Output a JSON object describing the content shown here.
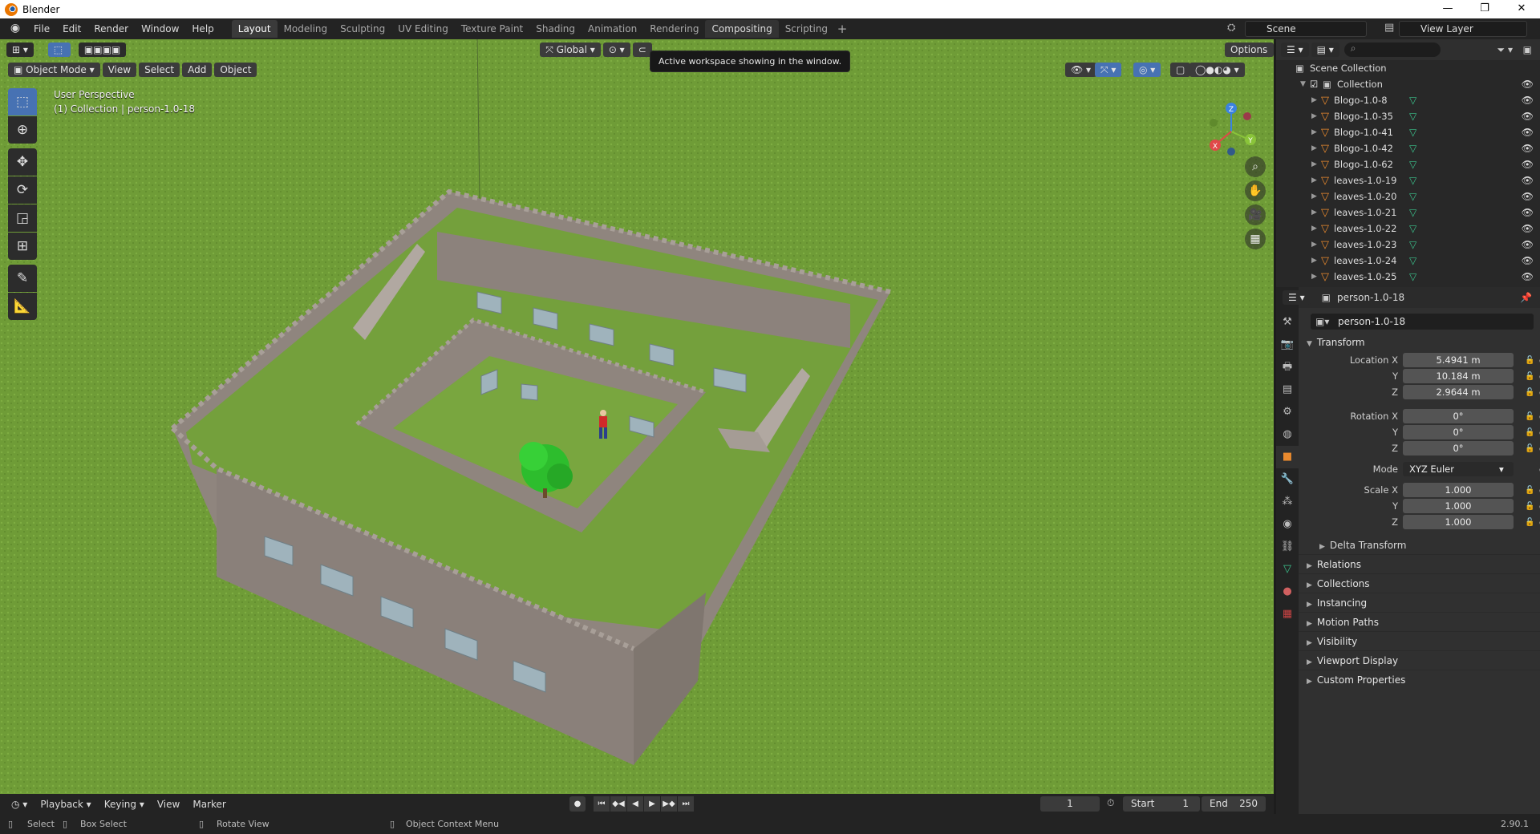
{
  "window": {
    "title": "Blender",
    "controls": [
      "—",
      "❐",
      "✕"
    ]
  },
  "menu": [
    "File",
    "Edit",
    "Render",
    "Window",
    "Help"
  ],
  "workspaces": [
    "Layout",
    "Modeling",
    "Sculpting",
    "UV Editing",
    "Texture Paint",
    "Shading",
    "Animation",
    "Rendering",
    "Compositing",
    "Scripting"
  ],
  "active_workspace": "Layout",
  "scene": {
    "name": "Scene",
    "view_layer": "View Layer"
  },
  "viewport": {
    "mode": "Object Mode",
    "menus": [
      "View",
      "Select",
      "Add",
      "Object"
    ],
    "transform_orientation": "Global",
    "options_label": "Options",
    "tooltip": "Active workspace showing in the window.",
    "overlay_line1": "User Perspective",
    "overlay_line2": "(1) Collection | person-1.0-18",
    "gizmo": {
      "x": "X",
      "y": "Y",
      "z": "Z"
    }
  },
  "timeline": {
    "menus": [
      "Playback",
      "Keying",
      "View",
      "Marker"
    ],
    "current_frame": "1",
    "start_label": "Start",
    "start": "1",
    "end_label": "End",
    "end": "250"
  },
  "statusbar": {
    "select": "Select",
    "box_select": "Box Select",
    "rotate_view": "Rotate View",
    "context_menu": "Object Context Menu",
    "version": "2.90.1"
  },
  "outliner": {
    "root": "Scene Collection",
    "collection": "Collection",
    "objects": [
      "Blogo-1.0-8",
      "Blogo-1.0-35",
      "Blogo-1.0-41",
      "Blogo-1.0-42",
      "Blogo-1.0-62",
      "leaves-1.0-19",
      "leaves-1.0-20",
      "leaves-1.0-21",
      "leaves-1.0-22",
      "leaves-1.0-23",
      "leaves-1.0-24",
      "leaves-1.0-25"
    ]
  },
  "properties": {
    "object_name": "person-1.0-18",
    "transform_label": "Transform",
    "location": {
      "label_x": "Location X",
      "x": "5.4941 m",
      "y": "10.184 m",
      "z": "2.9644 m"
    },
    "rotation": {
      "label_x": "Rotation X",
      "x": "0°",
      "y": "0°",
      "z": "0°"
    },
    "mode_label": "Mode",
    "mode": "XYZ Euler",
    "scale": {
      "label_x": "Scale X",
      "x": "1.000",
      "y": "1.000",
      "z": "1.000"
    },
    "axis_y": "Y",
    "axis_z": "Z",
    "delta_transform": "Delta Transform",
    "panels": [
      "Relations",
      "Collections",
      "Instancing",
      "Motion Paths",
      "Visibility",
      "Viewport Display",
      "Custom Properties"
    ]
  }
}
